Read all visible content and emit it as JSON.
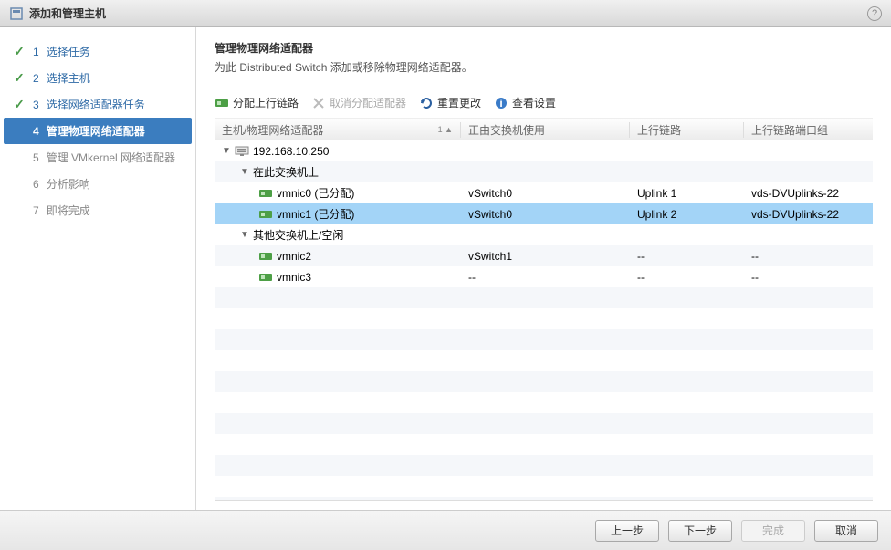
{
  "dialog": {
    "title": "添加和管理主机"
  },
  "steps": [
    {
      "num": "1",
      "label": "选择任务",
      "state": "done"
    },
    {
      "num": "2",
      "label": "选择主机",
      "state": "done"
    },
    {
      "num": "3",
      "label": "选择网络适配器任务",
      "state": "done"
    },
    {
      "num": "4",
      "label": "管理物理网络适配器",
      "state": "active"
    },
    {
      "num": "5",
      "label": "管理 VMkernel 网络适配器",
      "state": "pending"
    },
    {
      "num": "6",
      "label": "分析影响",
      "state": "pending"
    },
    {
      "num": "7",
      "label": "即将完成",
      "state": "pending"
    }
  ],
  "panel": {
    "title": "管理物理网络适配器",
    "desc": "为此 Distributed Switch 添加或移除物理网络适配器。"
  },
  "toolbar": {
    "assign": "分配上行链路",
    "unassign": "取消分配适配器",
    "reset": "重置更改",
    "view": "查看设置"
  },
  "columns": {
    "c1": "主机/物理网络适配器",
    "sort": "1 ▲",
    "c2": "正由交换机使用",
    "c3": "上行链路",
    "c4": "上行链路端口组"
  },
  "rows": [
    {
      "type": "host",
      "indent": 0,
      "expand": "▼",
      "label": "192.168.10.250",
      "c2": "",
      "c3": "",
      "c4": "",
      "selected": false
    },
    {
      "type": "group",
      "indent": 1,
      "expand": "▼",
      "label": "在此交换机上",
      "c2": "",
      "c3": "",
      "c4": "",
      "selected": false
    },
    {
      "type": "nic",
      "indent": 2,
      "expand": "",
      "label": "vmnic0 (已分配)",
      "c2": "vSwitch0",
      "c3": "Uplink 1",
      "c4": "vds-DVUplinks-22",
      "selected": false
    },
    {
      "type": "nic",
      "indent": 2,
      "expand": "",
      "label": "vmnic1 (已分配)",
      "c2": "vSwitch0",
      "c3": "Uplink 2",
      "c4": "vds-DVUplinks-22",
      "selected": true
    },
    {
      "type": "group",
      "indent": 1,
      "expand": "▼",
      "label": "其他交换机上/空闲",
      "c2": "",
      "c3": "",
      "c4": "",
      "selected": false
    },
    {
      "type": "nic",
      "indent": 2,
      "expand": "",
      "label": "vmnic2",
      "c2": "vSwitch1",
      "c3": "--",
      "c4": "--",
      "selected": false
    },
    {
      "type": "nic",
      "indent": 2,
      "expand": "",
      "label": "vmnic3",
      "c2": "--",
      "c3": "--",
      "c4": "--",
      "selected": false
    }
  ],
  "buttons": {
    "back": "上一步",
    "next": "下一步",
    "finish": "完成",
    "cancel": "取消"
  }
}
